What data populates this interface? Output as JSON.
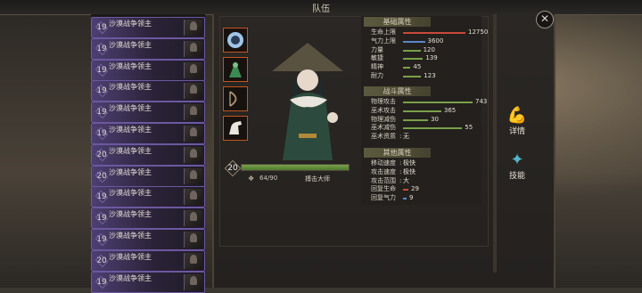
{
  "header": {
    "title": "队伍"
  },
  "roster": [
    {
      "level": "19",
      "name": "沙漠战争领主"
    },
    {
      "level": "19",
      "name": "沙漠战争领主"
    },
    {
      "level": "19",
      "name": "沙漠战争领主"
    },
    {
      "level": "19",
      "name": "沙漠战争领主"
    },
    {
      "level": "19",
      "name": "沙漠战争领主"
    },
    {
      "level": "19",
      "name": "沙漠战争领主"
    },
    {
      "level": "20",
      "name": "沙漠战争领主"
    },
    {
      "level": "20",
      "name": "沙漠战争领主"
    },
    {
      "level": "19",
      "name": "沙漠战争领主"
    },
    {
      "level": "19",
      "name": "沙漠战争领主"
    },
    {
      "level": "19",
      "name": "沙漠战争领主"
    },
    {
      "level": "20",
      "name": "沙漠战争领主"
    },
    {
      "level": "19",
      "name": "沙漠战争领主"
    }
  ],
  "character": {
    "level": "20",
    "exp": "64/90",
    "class": "搏击大师",
    "equipment": [
      "orb-icon",
      "cloak-icon",
      "bow-icon",
      "horse-icon"
    ]
  },
  "sections": {
    "basic": "基础属性",
    "combat": "战斗属性",
    "other": "其他属性"
  },
  "stats": {
    "basic": [
      {
        "label": "生命上限",
        "value": "12750",
        "bar": "red",
        "fill": 1.0
      },
      {
        "label": "气力上限",
        "value": "3600",
        "bar": "blue",
        "fill": 0.35
      },
      {
        "label": "力量",
        "value": "120",
        "bar": "green",
        "fill": 0.28
      },
      {
        "label": "敏捷",
        "value": "139",
        "bar": "green",
        "fill": 0.32
      },
      {
        "label": "精神",
        "value": "45",
        "bar": "green",
        "fill": 0.12
      },
      {
        "label": "耐力",
        "value": "123",
        "bar": "green",
        "fill": 0.29
      }
    ],
    "combat": [
      {
        "label": "物理攻击",
        "value": "743",
        "bar": "green",
        "fill": 1.0
      },
      {
        "label": "巫术攻击",
        "value": "365",
        "bar": "green",
        "fill": 0.55
      },
      {
        "label": "物理减伤",
        "value": "30",
        "bar": "green",
        "fill": 0.36
      },
      {
        "label": "巫术减伤",
        "value": "55",
        "bar": "green",
        "fill": 0.85
      },
      {
        "label": "巫术资质",
        "value": "无"
      }
    ],
    "other": [
      {
        "label": "移动速度",
        "value": "极快"
      },
      {
        "label": "攻击速度",
        "value": "极快"
      },
      {
        "label": "攻击范围",
        "value": "大"
      },
      {
        "label": "回复生命",
        "value": "29",
        "bar": "red",
        "fill": 0.15
      },
      {
        "label": "回复气力",
        "value": "9",
        "bar": "blue",
        "fill": 0.04
      }
    ]
  },
  "side_buttons": {
    "details": "详情",
    "skills": "技能"
  },
  "colors": {
    "red": "#c84a3a",
    "blue": "#5a86c8",
    "green": "#7aa04a"
  }
}
